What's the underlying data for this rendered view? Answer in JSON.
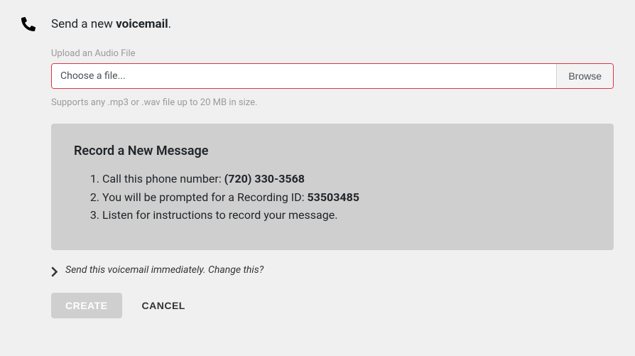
{
  "header": {
    "title_prefix": "Send a new ",
    "title_bold": "voicemail",
    "title_suffix": "."
  },
  "upload": {
    "label": "Upload an Audio File",
    "placeholder": "Choose a file...",
    "browse_label": "Browse",
    "help_text": "Supports any .mp3 or .wav file up to 20 MB in size."
  },
  "record": {
    "title": "Record a New Message",
    "step1_prefix": "Call this phone number: ",
    "step1_bold": "(720) 330-3568",
    "step2_prefix": "You will be prompted for a Recording ID: ",
    "step2_bold": "53503485",
    "step3": "Listen for instructions to record your message."
  },
  "schedule": {
    "text": "Send this voicemail immediately. Change this?"
  },
  "buttons": {
    "create": "CREATE",
    "cancel": "CANCEL"
  }
}
